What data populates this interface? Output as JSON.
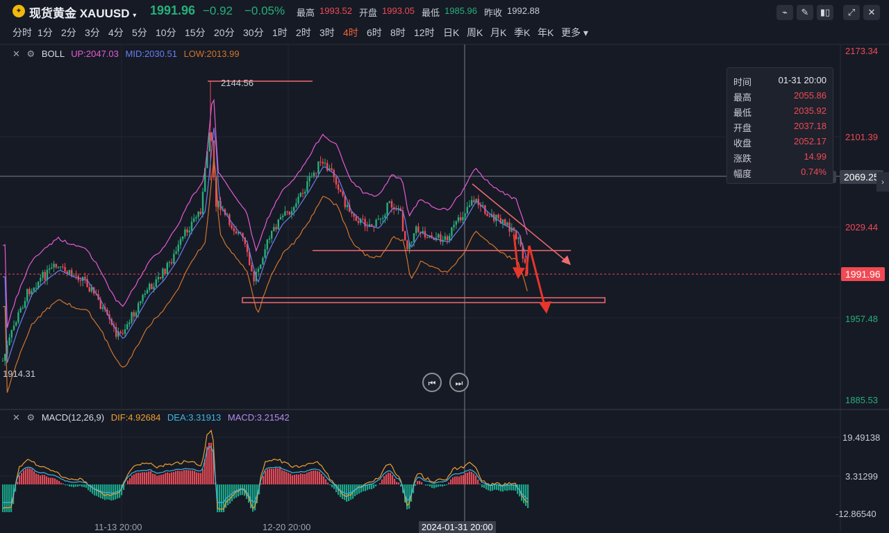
{
  "header": {
    "symbol": "现货黄金 XAUUSD",
    "price": "1991.96",
    "change": "−0.92",
    "change_pct": "−0.05%",
    "high_label": "最高",
    "high_value": "1993.52",
    "open_label": "开盘",
    "open_value": "1993.05",
    "low_label": "最低",
    "low_value": "1985.96",
    "prev_label": "昨收",
    "prev_value": "1992.88",
    "tool_icons": [
      "chart-settings-icon",
      "pen-draw-icon",
      "candle-type-icon",
      "fullscreen-icon",
      "close-icon"
    ]
  },
  "timeframes": [
    "分时",
    "1分",
    "2分",
    "3分",
    "4分",
    "5分",
    "10分",
    "15分",
    "20分",
    "30分",
    "1时",
    "2时",
    "3时",
    "4时",
    "6时",
    "8时",
    "12时",
    "日K",
    "周K",
    "月K",
    "季K",
    "年K",
    "更多"
  ],
  "active_timeframe": "4时",
  "boll": {
    "name": "BOLL",
    "up": "UP:2047.03",
    "mid": "MID:2030.51",
    "low": "LOW:2013.99",
    "colors": {
      "up": "#e85bd6",
      "mid": "#6a7ff0",
      "low": "#d4752a"
    }
  },
  "main_axis": {
    "t1": "2173.34",
    "t2": "2101.39",
    "t3": "2029.44",
    "t4": "1957.48",
    "t5": "1885.53"
  },
  "crosshair_value": "2069.25",
  "current_price_tag": "1991.96",
  "annotations": {
    "high_point": "2144.56",
    "low_point": "1914.31"
  },
  "infobox": {
    "time_k": "时间",
    "time_v": "01-31 20:00",
    "high_k": "最高",
    "high_v": "2055.86",
    "low_k": "最低",
    "low_v": "2035.92",
    "open_k": "开盘",
    "open_v": "2037.18",
    "close_k": "收盘",
    "close_v": "2052.17",
    "chg_k": "涨跌",
    "chg_v": "14.99",
    "amp_k": "幅度",
    "amp_v": "0.74%"
  },
  "macd": {
    "name": "MACD(12,26,9)",
    "dif": "DIF:4.92684",
    "dea": "DEA:3.31913",
    "macd": "MACD:3.21542",
    "colors": {
      "dif": "#f0a030",
      "dea": "#3db7e4",
      "macd": "#b48cf0"
    }
  },
  "macd_axis": {
    "t1": "19.49138",
    "t2": "3.31299",
    "t3": "-12.86540"
  },
  "time_axis": {
    "d1": "11-13 20:00",
    "d2": "12-20 20:00",
    "cursor": "2024-01-31 20:00"
  },
  "colors": {
    "up": "#26b07a",
    "down": "#f04a54",
    "bg": "#161a25",
    "accent": "#f06436"
  }
}
